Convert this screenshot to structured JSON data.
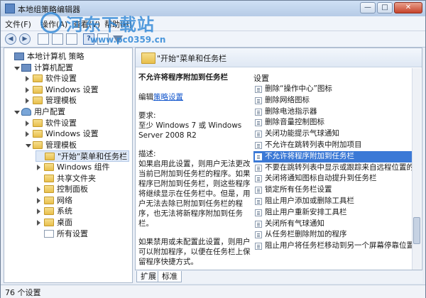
{
  "window": {
    "title": "本地组策略编辑器",
    "minimize": "—",
    "maximize": "□",
    "close": "✕"
  },
  "watermark": {
    "name": "河东下载站",
    "url": "www.pc0359.cn"
  },
  "menu": [
    {
      "label": "文件(F)"
    },
    {
      "label": "操作(A)"
    },
    {
      "label": "查看(V)"
    },
    {
      "label": "帮助(H)"
    }
  ],
  "toolbar": {
    "back": "◀",
    "forward": "▶",
    "help": "?"
  },
  "tree": [
    {
      "label": "本地计算机 策略",
      "level": 0,
      "expand": "none",
      "icon": "computer"
    },
    {
      "label": "计算机配置",
      "level": 1,
      "expand": "open",
      "icon": "computer"
    },
    {
      "label": "软件设置",
      "level": 2,
      "expand": "closed",
      "icon": "folder"
    },
    {
      "label": "Windows 设置",
      "level": 2,
      "expand": "closed",
      "icon": "folder"
    },
    {
      "label": "管理模板",
      "level": 2,
      "expand": "closed",
      "icon": "folder"
    },
    {
      "label": "用户配置",
      "level": 1,
      "expand": "open",
      "icon": "user"
    },
    {
      "label": "软件设置",
      "level": 2,
      "expand": "closed",
      "icon": "folder"
    },
    {
      "label": "Windows 设置",
      "level": 2,
      "expand": "closed",
      "icon": "folder"
    },
    {
      "label": "管理模板",
      "level": 2,
      "expand": "open",
      "icon": "folder"
    },
    {
      "label": "\"开始\"菜单和任务栏",
      "level": 3,
      "expand": "none",
      "icon": "folder",
      "selected": true
    },
    {
      "label": "Windows 组件",
      "level": 3,
      "expand": "closed",
      "icon": "folder"
    },
    {
      "label": "共享文件夹",
      "level": 3,
      "expand": "none",
      "icon": "folder"
    },
    {
      "label": "控制面板",
      "level": 3,
      "expand": "closed",
      "icon": "folder"
    },
    {
      "label": "网络",
      "level": 3,
      "expand": "closed",
      "icon": "folder"
    },
    {
      "label": "系统",
      "level": 3,
      "expand": "closed",
      "icon": "folder"
    },
    {
      "label": "桌面",
      "level": 3,
      "expand": "closed",
      "icon": "folder"
    },
    {
      "label": "所有设置",
      "level": 3,
      "expand": "none",
      "icon": "doc"
    }
  ],
  "content": {
    "header": "\"开始\"菜单和任务栏",
    "desc_title": "不允许将程序附加到任务栏",
    "edit_prefix": "编辑",
    "edit_link": "策略设置",
    "requirements_label": "要求:",
    "requirements": "至少 Windows 7 或 Windows Server 2008 R2",
    "description_label": "描述:",
    "description": "如果启用此设置，则用户无法更改当前已附加到任务栏的程序。如果程序已附加到任务栏，则这些程序将继续显示在任务栏中。但是，用户无法去除已附加到任务栏的程序，也无法将新程序附加到任务栏。",
    "description2": "如果禁用或未配置此设置，则用户可以附加程序，以便在任务栏上保留程序快捷方式。",
    "list_header": "设置",
    "settings": [
      "删除“操作中心”图标",
      "删除网络图标",
      "删除电池指示器",
      "删除音量控制图标",
      "关闭功能提示气球通知",
      "不允许在跳转列表中附加项目",
      "不允许将程序附加到任务栏",
      "不要在跳转列表中显示或跟踪来自远程位置的项目",
      "关闭将通知图标自动提升到任务栏",
      "锁定所有任务栏设置",
      "阻止用户添加或删除工具栏",
      "阻止用户重新安排工具栏",
      "关闭所有气球通知",
      "从任务栏删除附加的程序",
      "阻止用户将任务栏移动到另一个屏幕停靠位置"
    ],
    "selected_index": 6
  },
  "tabs": [
    {
      "label": "扩展",
      "active": false
    },
    {
      "label": "标准",
      "active": true
    }
  ],
  "status": "76 个设置"
}
